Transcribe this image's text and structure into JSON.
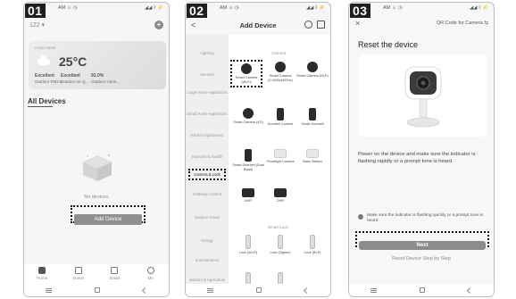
{
  "steps": [
    "01",
    "02",
    "03"
  ],
  "status": {
    "left": "AM ☺ ◷",
    "right": "◢◢ ⌇ ⚡"
  },
  "phone1": {
    "home_name": "122 ▾",
    "add": "+",
    "weather": {
      "city": "Cozy Home",
      "temp": "25°C",
      "stats": [
        {
          "value": "Excellent",
          "label": "Outdoor PM2.5"
        },
        {
          "value": "Excellent",
          "label": "Outdoor Air Q..."
        },
        {
          "value": "92.0%",
          "label": "Outdoor Humi..."
        }
      ]
    },
    "all_devices": "All Devices",
    "no_devices": "No devices",
    "add_device_button": "Add Device",
    "tabs": [
      {
        "label": "Home"
      },
      {
        "label": "Scene"
      },
      {
        "label": "Smart"
      },
      {
        "label": "Me"
      }
    ]
  },
  "phone2": {
    "title": "Add Device",
    "back": "<",
    "categories": [
      "Lighting",
      "Sensors",
      "Large Home Appliances",
      "Small Home Appliances",
      "Kitchen Appliances",
      "Exercise & Health",
      "Camera & Lock",
      "Gateway Control",
      "Outdoor Travel",
      "Energy",
      "Entertainment",
      "Industry & Agriculture"
    ],
    "sections": {
      "camera": "Camera",
      "smart_lock": "Smart Lock"
    },
    "devices": [
      "Smart Camera (Wi-Fi)",
      "Smart Camera (2.4GHz&5GHz)",
      "Smart Camera (BLE)",
      "Smart Camera (4G)",
      "Doorbell Camera",
      "Smart Doorbell",
      "Smart Doorbell (Dual Band)",
      "Floodlight Camera",
      "Base Station",
      "NVR",
      "DVR",
      "Lock (Wi-Fi)",
      "Lock (Zigbee)",
      "Lock (BLE)"
    ]
  },
  "phone3": {
    "close": "×",
    "qr_label": "QR Code for Camera ⇆",
    "heading": "Reset the device",
    "instructions": "Power on the device and make sure the indicator is flashing rapidly or a prompt tone is heard.",
    "confirm_text": "Make sure the indicator is flashing quickly or a prompt tone is heard.",
    "next_button": "Next",
    "reset_link": "Reset Device Step by Step"
  }
}
